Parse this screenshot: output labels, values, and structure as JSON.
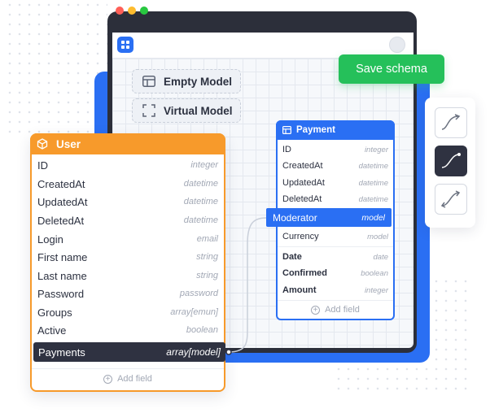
{
  "window": {
    "traffic_colors": [
      "#ff5f57",
      "#febc2e",
      "#28c840"
    ]
  },
  "chips": [
    {
      "icon": "table-icon",
      "label": "Empty Model"
    },
    {
      "icon": "frame-icon",
      "label": "Virtual Model"
    }
  ],
  "toolbar": {
    "save_label": "Save schema"
  },
  "side_panel": {
    "curve_options": [
      "curve-style-1",
      "curve-style-2",
      "curve-style-3"
    ],
    "active_index": 1
  },
  "user_table": {
    "title": "User",
    "rows": [
      {
        "name": "ID",
        "type": "integer"
      },
      {
        "name": "CreatedAt",
        "type": "datetime"
      },
      {
        "name": "UpdatedAt",
        "type": "datetime"
      },
      {
        "name": "DeletedAt",
        "type": "datetime"
      },
      {
        "name": "Login",
        "type": "email"
      },
      {
        "name": "First name",
        "type": "string"
      },
      {
        "name": "Last name",
        "type": "string"
      },
      {
        "name": "Password",
        "type": "password"
      },
      {
        "name": "Groups",
        "type": "array[emun]"
      },
      {
        "name": "Active",
        "type": "boolean"
      }
    ],
    "selected_row": {
      "name": "Payments",
      "type": "array[model]"
    },
    "add_field": "Add field"
  },
  "payment_table": {
    "title": "Payment",
    "rows_top": [
      {
        "name": "ID",
        "type": "integer"
      },
      {
        "name": "CreatedAt",
        "type": "datetime"
      },
      {
        "name": "UpdatedAt",
        "type": "datetime"
      },
      {
        "name": "DeletedAt",
        "type": "datetime"
      }
    ],
    "selected_row": {
      "name": "Moderator",
      "type": "model"
    },
    "rows_mid": [
      {
        "name": "Currency",
        "type": "model"
      }
    ],
    "rows_bold": [
      {
        "name": "Date",
        "type": "date"
      },
      {
        "name": "Confirmed",
        "type": "boolean"
      },
      {
        "name": "Amount",
        "type": "integer"
      }
    ],
    "add_field": "Add field"
  },
  "colors": {
    "accent_blue": "#2a6ff3",
    "accent_orange": "#f79a2b",
    "accent_green": "#25c05a",
    "dark": "#2f3241"
  }
}
